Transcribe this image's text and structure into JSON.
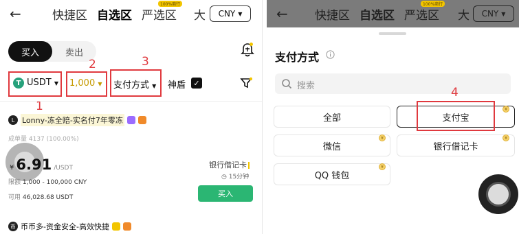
{
  "left": {
    "topbar": {
      "tabs": [
        "快捷区",
        "自选区",
        "严选区"
      ],
      "tab_badge": "100%商行",
      "big_label": "大",
      "currency": "CNY"
    },
    "trade_toggle": {
      "buy": "买入",
      "sell": "卖出"
    },
    "filters": {
      "asset": "USDT",
      "amount": "1,000",
      "payment": "支付方式",
      "shield": "神盾",
      "checkbox_mark": "✓"
    },
    "annotations": [
      "1",
      "2",
      "3"
    ],
    "listing": {
      "merchant_name": "Lonny-冻全赔-实名付7年零冻",
      "stats": "成单量 4137 (100.00%)",
      "price_symbol": "¥",
      "price": "6.91",
      "price_unit": "/USDT",
      "limit_label": "限额",
      "limit_value": "1,000 - 100,000 CNY",
      "avail_label": "可用",
      "avail_value": "46,028.68 USDT",
      "payment_method": "银行借记卡",
      "time": "15分钟",
      "buy_button": "买入"
    },
    "listing2": {
      "merchant_name": "币币多-资金安全-高效快捷"
    }
  },
  "right": {
    "sheet_title": "支付方式",
    "search_placeholder": "搜索",
    "payments": [
      "全部",
      "支付宝",
      "微信",
      "银行借记卡",
      "QQ 钱包"
    ],
    "annotation": "4"
  },
  "colors": {
    "annotation_red": "#e0393e",
    "buy_green": "#2bb673",
    "amount_gold": "#c59a00"
  }
}
